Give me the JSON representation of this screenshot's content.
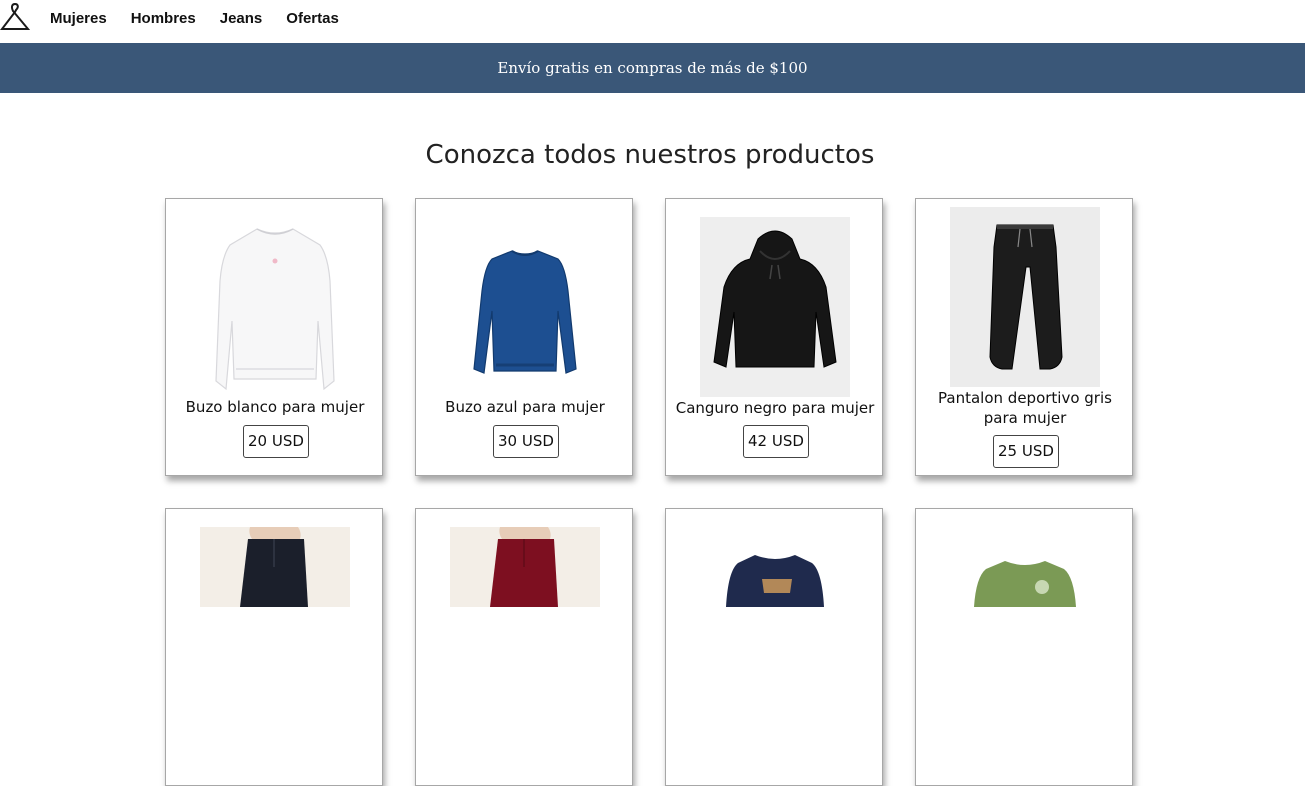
{
  "nav": {
    "logo": "hanger-icon",
    "links": [
      "Mujeres",
      "Hombres",
      "Jeans",
      "Ofertas"
    ]
  },
  "banner": {
    "text": "Envío gratis en compras de más de $100"
  },
  "main": {
    "title": "Conozca todos nuestros productos"
  },
  "products": [
    {
      "name": "Buzo blanco para mujer",
      "price": "20 USD",
      "image": "white-sweater-image"
    },
    {
      "name": "Buzo azul para mujer",
      "price": "30 USD",
      "image": "blue-sweater-image"
    },
    {
      "name": "Canguro negro para mujer",
      "price": "42 USD",
      "image": "black-hoodie-image"
    },
    {
      "name": "Pantalon deportivo gris para mujer",
      "price": "25 USD",
      "image": "grey-joggers-image"
    },
    {
      "name": "",
      "price": "",
      "image": "black-jeans-image"
    },
    {
      "name": "",
      "price": "",
      "image": "burgundy-pants-image"
    },
    {
      "name": "",
      "price": "",
      "image": "navy-sweatshirt-image"
    },
    {
      "name": "",
      "price": "",
      "image": "green-sweatshirt-image"
    }
  ],
  "colors": {
    "banner": "#3a5778",
    "white": "#ffffff",
    "text": "#111111"
  }
}
